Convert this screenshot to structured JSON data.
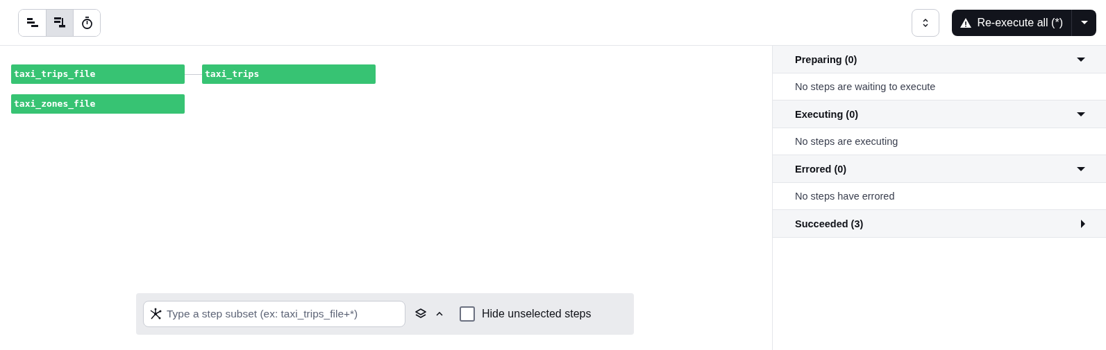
{
  "view_modes": [
    {
      "kind": "flat",
      "selected": false
    },
    {
      "kind": "tree",
      "selected": true
    },
    {
      "kind": "timer",
      "selected": false
    }
  ],
  "reexecute_button": {
    "label": "Re-execute all (*)"
  },
  "graph": {
    "nodes": [
      {
        "label": "taxi_trips_file",
        "children": [
          {
            "label": "taxi_trips"
          }
        ]
      },
      {
        "label": "taxi_zones_file"
      }
    ]
  },
  "subset_bar": {
    "placeholder": "Type a step subset (ex: taxi_trips_file+*)",
    "hide_unselected": {
      "label": "Hide unselected steps",
      "checked": false
    }
  },
  "sections": [
    {
      "title": "Preparing (0)",
      "expanded": true,
      "empty_text": "No steps are waiting to execute"
    },
    {
      "title": "Executing (0)",
      "expanded": true,
      "empty_text": "No steps are executing"
    },
    {
      "title": "Errored (0)",
      "expanded": true,
      "empty_text": "No steps have errored"
    },
    {
      "title": "Succeeded (3)",
      "expanded": false
    }
  ]
}
